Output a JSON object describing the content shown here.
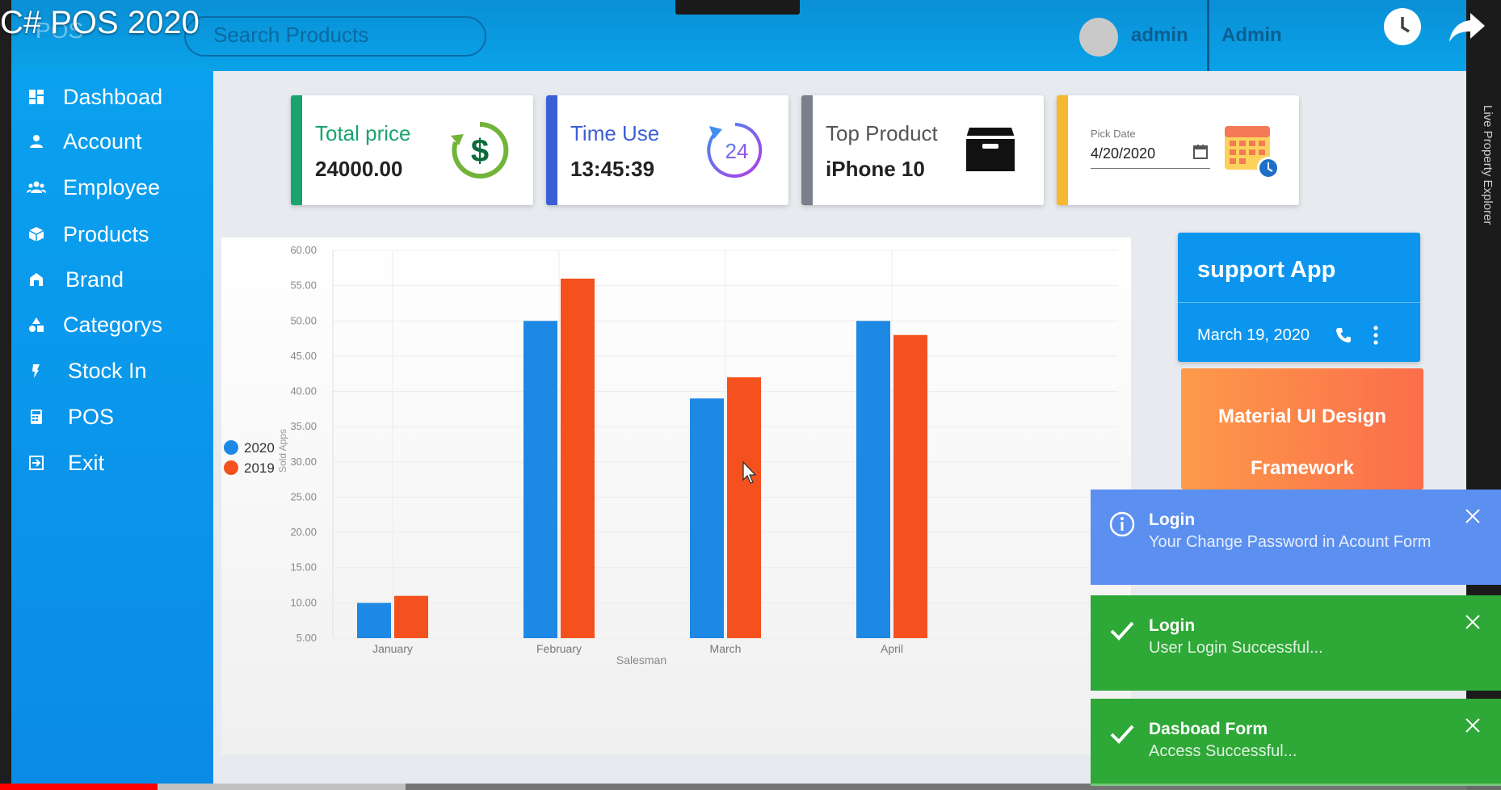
{
  "video": {
    "title": "C# POS 2020"
  },
  "header": {
    "app_title": "POS",
    "search_placeholder": "Search Products",
    "user_name": "admin",
    "role": "Admin"
  },
  "sidebar": {
    "items": [
      {
        "label": "Dashboad",
        "icon": "dashboard-icon"
      },
      {
        "label": "Account",
        "icon": "account-icon"
      },
      {
        "label": "Employee",
        "icon": "employee-icon"
      },
      {
        "label": "Products",
        "icon": "products-icon"
      },
      {
        "label": "Brand",
        "icon": "brand-icon"
      },
      {
        "label": "Categorys",
        "icon": "categories-icon"
      },
      {
        "label": "Stock In",
        "icon": "stock-in-icon"
      },
      {
        "label": "POS",
        "icon": "pos-icon"
      },
      {
        "label": "Exit",
        "icon": "exit-icon"
      }
    ]
  },
  "cards": {
    "total_price": {
      "title": "Total price",
      "value": "24000.00",
      "color": "#1aa36f"
    },
    "time_use": {
      "title": "Time Use",
      "value": "13:45:39",
      "color": "#3d5fd6"
    },
    "top_product": {
      "title": "Top Product",
      "value": "iPhone 10",
      "color": "#7a7f8c"
    },
    "pick_date": {
      "label": "Pick Date",
      "value": "4/20/2020",
      "color": "#f5b82e"
    }
  },
  "support": {
    "title": "support App",
    "date": "March 19, 2020"
  },
  "material": {
    "line1": "Material UI Design",
    "line2": "Framework"
  },
  "notifications": [
    {
      "title": "Login",
      "message": "Your Change Password in Acount Form",
      "type": "info",
      "color": "#5b8ff0"
    },
    {
      "title": "Login",
      "message": "User Login Successful...",
      "type": "success",
      "color": "#2ea836"
    },
    {
      "title": "Dasboad Form",
      "message": "Access Successful...",
      "type": "success",
      "color": "#2ea836"
    }
  ],
  "right_panel": {
    "label": "Live Property Explorer"
  },
  "playback": {
    "progress_fraction": 0.105
  },
  "chart_data": {
    "type": "bar",
    "categories": [
      "January",
      "February",
      "March",
      "April"
    ],
    "series": [
      {
        "name": "2020",
        "values": [
          10,
          50,
          39,
          50
        ],
        "color": "#1e88e5"
      },
      {
        "name": "2019",
        "values": [
          11,
          56,
          42,
          48
        ],
        "color": "#f4511e"
      }
    ],
    "xlabel": "Salesman",
    "ylabel": "Sold Apps",
    "ylim": [
      5,
      60
    ],
    "yticks": [
      "5.00",
      "10.00",
      "15.00",
      "20.00",
      "25.00",
      "30.00",
      "35.00",
      "40.00",
      "45.00",
      "50.00",
      "55.00",
      "60.00"
    ],
    "grid": true,
    "legend_position": "left"
  }
}
